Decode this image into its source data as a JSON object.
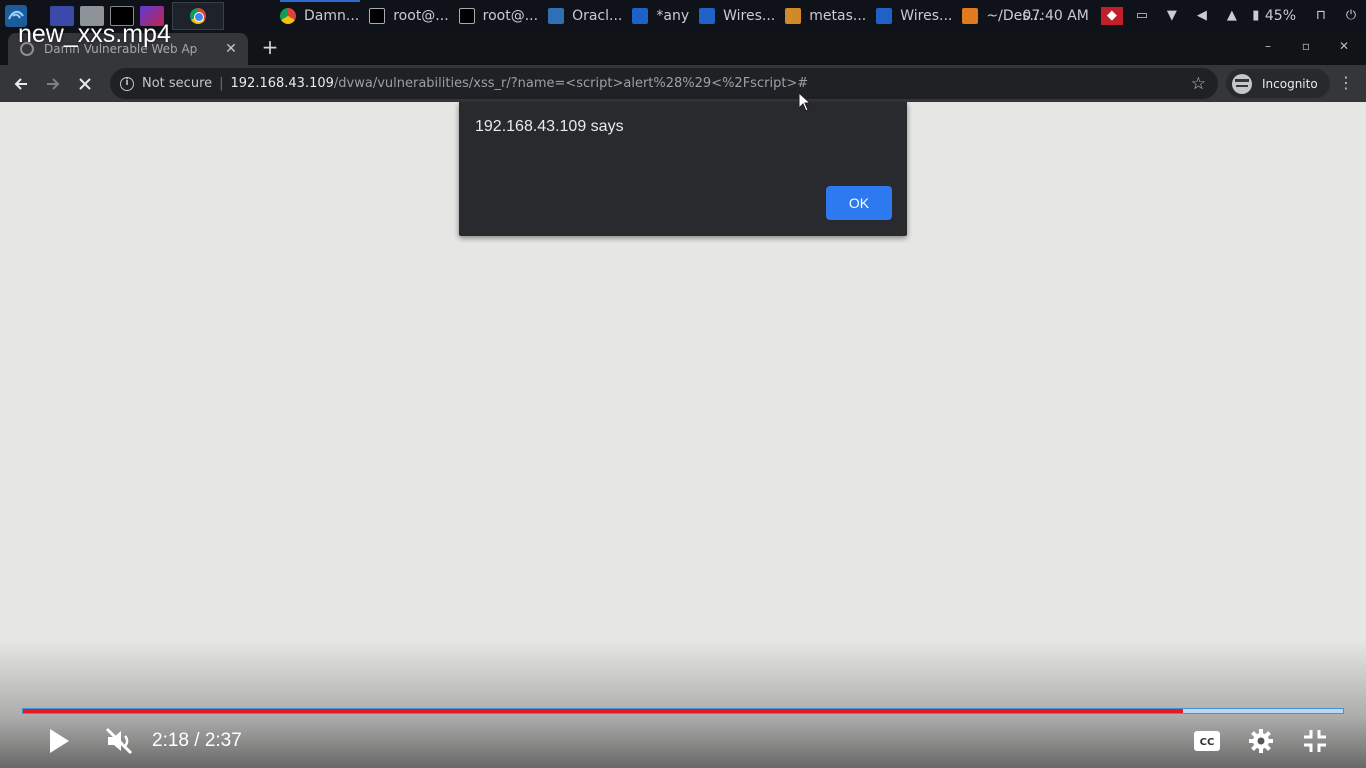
{
  "video": {
    "title": "new_xxs.mp4",
    "time_current": "2:18",
    "time_separator": "/",
    "time_total": "2:37",
    "progress_fraction": 0.879
  },
  "taskbar": {
    "tasks": [
      {
        "label": "Damn...",
        "icon": "chrome-icon"
      },
      {
        "label": "root@...",
        "icon": "terminal-icon"
      },
      {
        "label": "root@...",
        "icon": "terminal-icon"
      },
      {
        "label": "Oracl...",
        "icon": "virtualbox-icon"
      },
      {
        "label": "*any",
        "icon": "wireshark-icon"
      },
      {
        "label": "Wires...",
        "icon": "wireshark-icon"
      },
      {
        "label": "metas...",
        "icon": "metasploit-icon"
      },
      {
        "label": "Wires...",
        "icon": "wireshark-icon"
      },
      {
        "label": "~/Des...",
        "icon": "sublime-icon"
      }
    ],
    "clock": "07:40 AM",
    "battery": "45%"
  },
  "browser": {
    "tab_title": "Damn Vulnerable Web Ap",
    "security_label": "Not secure",
    "separator": "|",
    "url_host": "192.168.43.109",
    "url_path": "/dvwa/vulnerabilities/xss_r/?name=<script>alert%28%29<%2Fscript>#",
    "incognito_label": "Incognito"
  },
  "dialog": {
    "title": "192.168.43.109 says",
    "ok_label": "OK"
  },
  "colors": {
    "progress_played": "#e21b24",
    "ok_button": "#2c79f0",
    "dialog_bg": "#292a2d",
    "page_bg": "#e6e6e4"
  }
}
